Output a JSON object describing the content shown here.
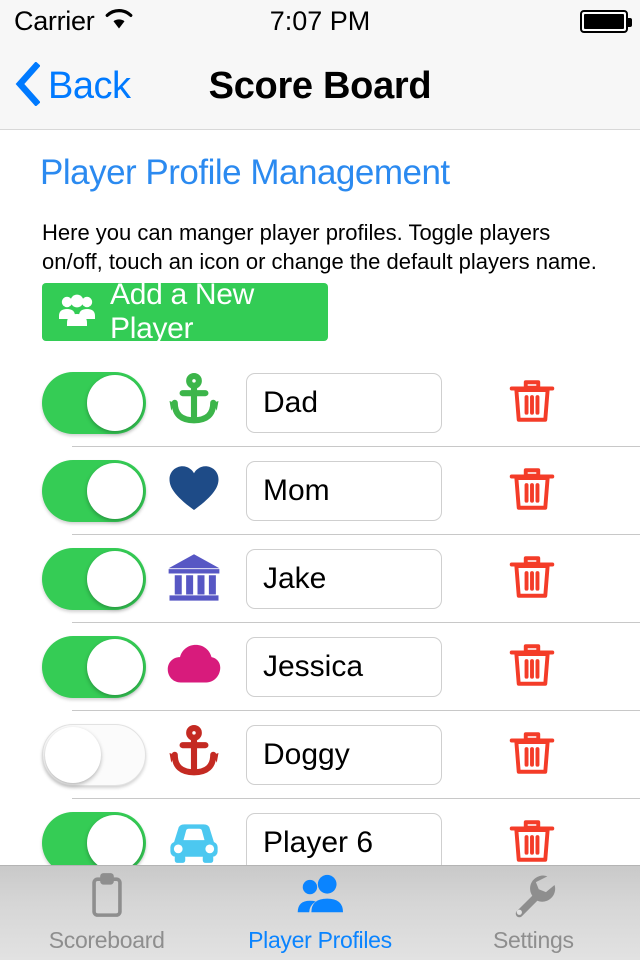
{
  "status_bar": {
    "carrier": "Carrier",
    "wifi_icon": "wifi-icon",
    "time": "7:07 PM",
    "battery_icon": "battery-full-icon"
  },
  "nav_bar": {
    "back_label": "Back",
    "back_icon": "chevron-left-icon",
    "title": "Score Board",
    "tint_color": "#007AFF"
  },
  "main": {
    "page_title": "Player Profile Management",
    "description": "Here you can manger player profiles.  Toggle players on/off, touch an icon or change the default players name.",
    "add_button": {
      "label": "Add a New Player",
      "icon": "group-people-icon",
      "color": "#33CC55"
    },
    "delete_icon": "trash-icon",
    "delete_color": "#F43C28",
    "toggle_on_color": "#35CC55",
    "players": [
      {
        "enabled": true,
        "toggle_state": "on",
        "icon": "anchor-icon",
        "icon_color": "#3CB54A",
        "name": "Dad"
      },
      {
        "enabled": true,
        "toggle_state": "on",
        "icon": "heart-icon",
        "icon_color": "#1E4B87",
        "name": "Mom"
      },
      {
        "enabled": true,
        "toggle_state": "on",
        "icon": "bank-icon",
        "icon_color": "#5757C4",
        "name": "Jake"
      },
      {
        "enabled": true,
        "toggle_state": "on",
        "icon": "cloud-icon",
        "icon_color": "#D81B7C",
        "name": "Jessica"
      },
      {
        "enabled": false,
        "toggle_state": "off",
        "icon": "anchor-icon",
        "icon_color": "#C42A22",
        "name": "Doggy"
      },
      {
        "enabled": true,
        "toggle_state": "on",
        "icon": "car-icon",
        "icon_color": "#4CC8F0",
        "name": "Player 6"
      }
    ]
  },
  "tab_bar": {
    "tabs": [
      {
        "label": "Scoreboard",
        "icon": "clipboard-icon",
        "active": false
      },
      {
        "label": "Player Profiles",
        "icon": "two-people-icon",
        "active": true
      },
      {
        "label": "Settings",
        "icon": "wrench-icon",
        "active": false
      }
    ],
    "active_color": "#0A84FF",
    "inactive_color": "#8E8E8E"
  }
}
